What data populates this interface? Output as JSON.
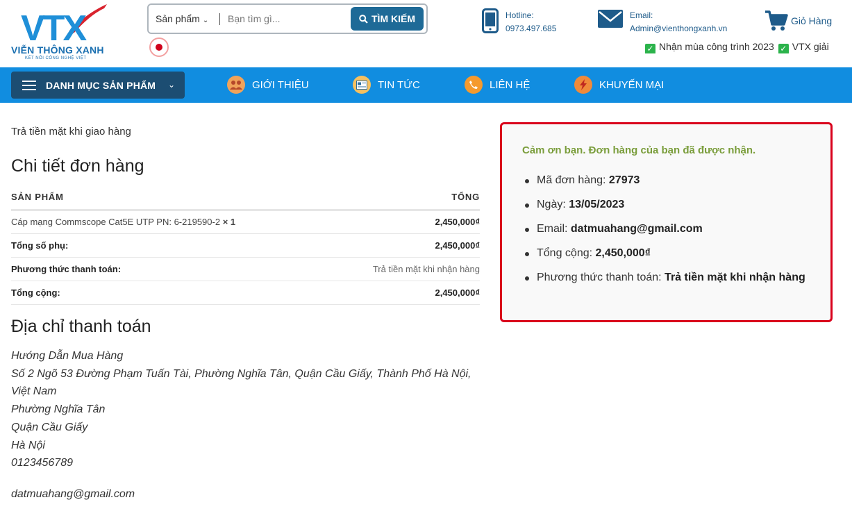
{
  "header": {
    "logo": {
      "mark": "VTX",
      "name": "VIỄN THÔNG XANH",
      "tagline": "KẾT NỐI CÔNG NGHỆ VIỆT"
    },
    "search": {
      "category": "Sản phẩm",
      "placeholder": "Bạn tìm gì...",
      "button": "TÌM KIẾM"
    },
    "hotline": {
      "label": "Hotline:",
      "value": "0973.497.685"
    },
    "email": {
      "label": "Email:",
      "value": "Admin@vienthongxanh.vn"
    },
    "cart_label": "Giỏ Hàng",
    "ticker": [
      "Nhận mùa công trình 2023",
      "VTX giải"
    ]
  },
  "nav": {
    "menu_label": "DANH MỤC SẢN PHẨM",
    "items": [
      {
        "label": "GIỚI THIỆU",
        "icon": "team-icon",
        "color": "#f0a35a"
      },
      {
        "label": "TIN TỨC",
        "icon": "news-icon",
        "color": "#f5c060"
      },
      {
        "label": "LIÊN HỆ",
        "icon": "phone-icon",
        "color": "#f59a2e"
      },
      {
        "label": "KHUYẾN MẠI",
        "icon": "lightning-icon",
        "color": "#f08a3a"
      }
    ]
  },
  "order": {
    "payment_note": "Trả tiền mặt khi giao hàng",
    "title": "Chi tiết đơn hàng",
    "col_product": "SẢN PHẨM",
    "col_total": "TỔNG",
    "item_name": "Cáp mạng Commscope Cat5E UTP PN: 6-219590-2",
    "item_qty": "× 1",
    "item_total": "2,450,000₫",
    "subtotal_label": "Tổng số phụ:",
    "subtotal_value": "2,450,000₫",
    "method_label": "Phương thức thanh toán:",
    "method_value": "Trả tiền mặt khi nhận hàng",
    "total_label": "Tổng cộng:",
    "total_value": "2,450,000₫"
  },
  "billing": {
    "title": "Địa chỉ thanh toán",
    "lines": [
      "Hướng Dẫn Mua Hàng",
      "Số 2 Ngõ 53 Đường Phạm Tuấn Tài, Phường Nghĩa Tân, Quận Cầu Giấy, Thành Phố Hà Nội,",
      "Việt Nam",
      "Phường Nghĩa Tân",
      "Quận Cầu Giấy",
      "Hà Nội",
      "0123456789"
    ],
    "email": "datmuahang@gmail.com"
  },
  "thanks": {
    "message": "Cảm ơn bạn. Đơn hàng của bạn đã được nhận.",
    "order_no_label": "Mã đơn hàng:",
    "order_no": "27973",
    "date_label": "Ngày:",
    "date": "13/05/2023",
    "email_label": "Email:",
    "email": "datmuahang@gmail.com",
    "total_label": "Tổng cộng:",
    "total": "2,450,000₫",
    "method_label": "Phương thức thanh toán:",
    "method": "Trả tiền mặt khi nhận hàng"
  },
  "colors": {
    "nav": "#118de0",
    "menu": "#1c4d72",
    "brand": "#1a6fb0",
    "accent_red": "#d9001b",
    "success": "#7a9d3b"
  }
}
